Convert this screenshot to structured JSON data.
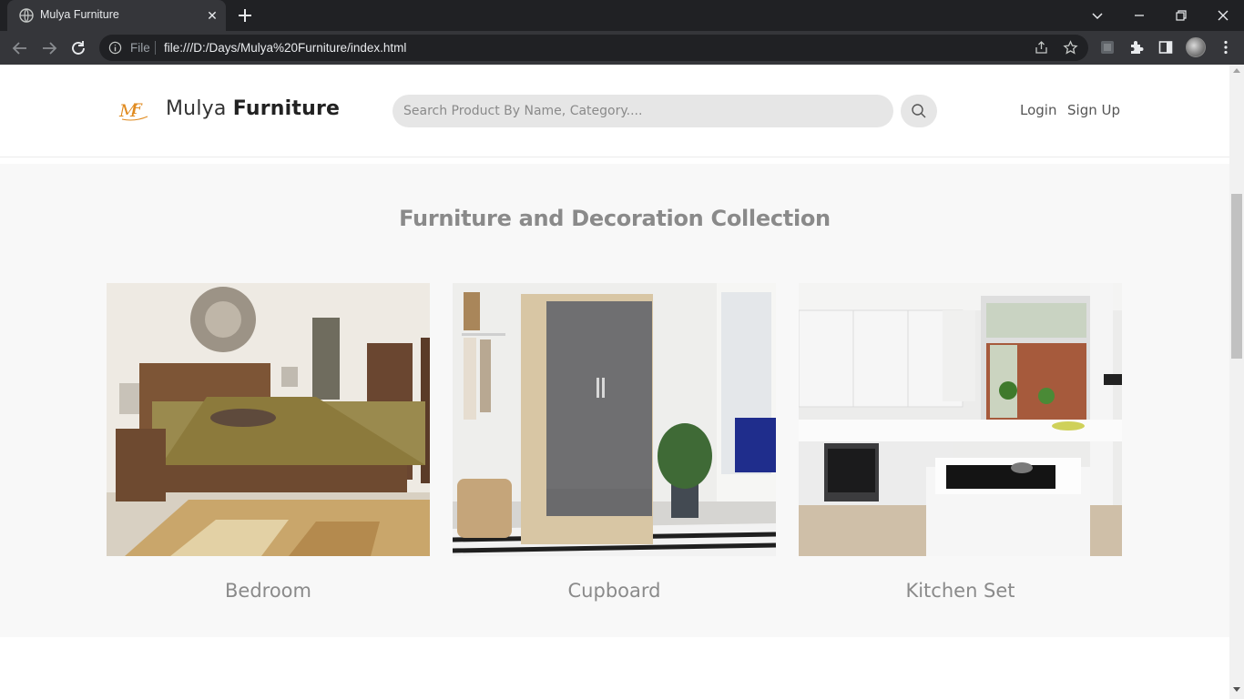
{
  "browser": {
    "tab_title": "Mulya Furniture",
    "omnibox_scheme_label": "File",
    "url": "file:///D:/Days/Mulya%20Furniture/index.html"
  },
  "header": {
    "brand_light": "Mulya ",
    "brand_bold": "Furniture",
    "search_placeholder": "Search Product By Name, Category....",
    "login_label": "Login",
    "signup_label": "Sign Up"
  },
  "collection": {
    "title": "Furniture and Decoration Collection",
    "items": [
      {
        "label": "Bedroom"
      },
      {
        "label": "Cupboard"
      },
      {
        "label": "Kitchen Set"
      }
    ]
  },
  "colors": {
    "brand_accent": "#e08a1e",
    "section_bg": "#f8f8f8",
    "muted_text": "#8a8a8a"
  }
}
